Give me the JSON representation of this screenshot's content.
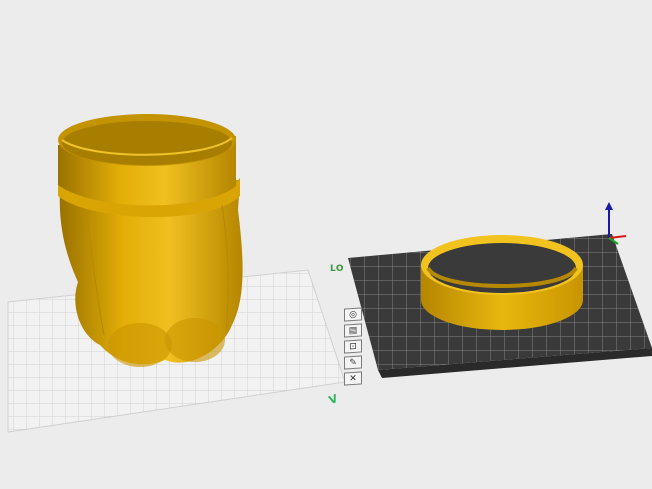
{
  "scene": {
    "bed_label": "LO",
    "corner_marker": "V",
    "model_color": "#e2ae07",
    "background_color": "#ececec",
    "bed_color": "#3a3a3a",
    "grid_color": "#d4d4d4",
    "axis_z_color": "#1a1aa8",
    "axis_x_color": "#d81818",
    "axis_y_color": "#18a818"
  },
  "toolbar": {
    "items": [
      {
        "icon": "view-icon",
        "glyph": "◎"
      },
      {
        "icon": "print-icon",
        "glyph": "▤"
      },
      {
        "icon": "scale-icon",
        "glyph": "⊡"
      },
      {
        "icon": "edit-icon",
        "glyph": "✎"
      },
      {
        "icon": "delete-icon",
        "glyph": "✕"
      }
    ]
  }
}
